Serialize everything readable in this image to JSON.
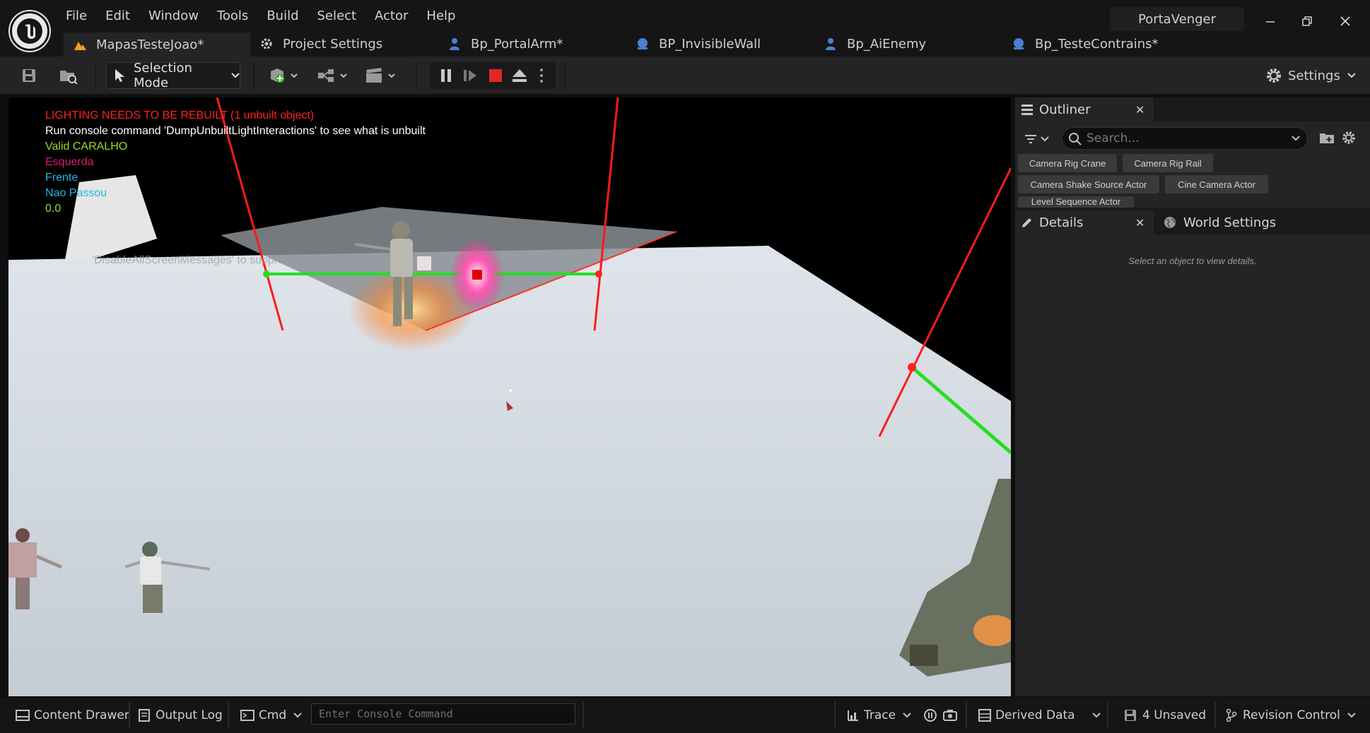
{
  "app": {
    "project_name": "PortaVenger"
  },
  "menu": [
    "File",
    "Edit",
    "Window",
    "Tools",
    "Build",
    "Select",
    "Actor",
    "Help"
  ],
  "tabs": [
    {
      "label": "MapasTesteJoao*",
      "icon": "level-icon"
    },
    {
      "label": "Project Settings",
      "icon": "settings-cog-icon"
    },
    {
      "label": "Bp_PortalArm*",
      "icon": "actor-blueprint-icon"
    },
    {
      "label": "BP_InvisibleWall",
      "icon": "blueprint-icon"
    },
    {
      "label": "Bp_AiEnemy",
      "icon": "actor-blueprint-icon"
    },
    {
      "label": "Bp_TesteContrains*",
      "icon": "blueprint-icon"
    }
  ],
  "toolbar": {
    "mode_label": "Selection Mode",
    "settings_label": "Settings"
  },
  "viewport": {
    "messages": [
      {
        "text": "LIGHTING NEEDS TO BE REBUILT (1 unbuilt object)",
        "color": "#ff2020"
      },
      {
        "text": "Run console command 'DumpUnbuiltLightInteractions' to see what is unbuilt",
        "color": "#ffffff"
      },
      {
        "text": "Valid CARALHO",
        "color": "#9bdc1e"
      },
      {
        "text": "Esquerda",
        "color": "#e0186e"
      },
      {
        "text": "Frente",
        "color": "#20b8e0"
      },
      {
        "text": "Nao Passou",
        "color": "#20b8e0"
      },
      {
        "text": "0.0",
        "color": "#9bdc1e"
      }
    ],
    "suppress_hint": "'DisableAllScreenMessages' to suppress"
  },
  "outliner": {
    "title": "Outliner",
    "search_placeholder": "Search...",
    "chips": [
      "Camera Rig Crane",
      "Camera Rig Rail",
      "Camera Shake Source Actor",
      "Cine Camera Actor",
      "Level Sequence Actor"
    ]
  },
  "details": {
    "title": "Details",
    "world_settings": "World Settings",
    "empty_message": "Select an object to view details."
  },
  "statusbar": {
    "content_drawer": "Content Drawer",
    "output_log": "Output Log",
    "cmd": "Cmd",
    "console_placeholder": "Enter Console Command",
    "trace": "Trace",
    "derived_data": "Derived Data",
    "unsaved": "4 Unsaved",
    "revision_control": "Revision Control"
  },
  "colors": {
    "accent_orange": "#f0a020",
    "blueprint_blue": "#4a7fd4",
    "stop_red": "#e02828"
  }
}
